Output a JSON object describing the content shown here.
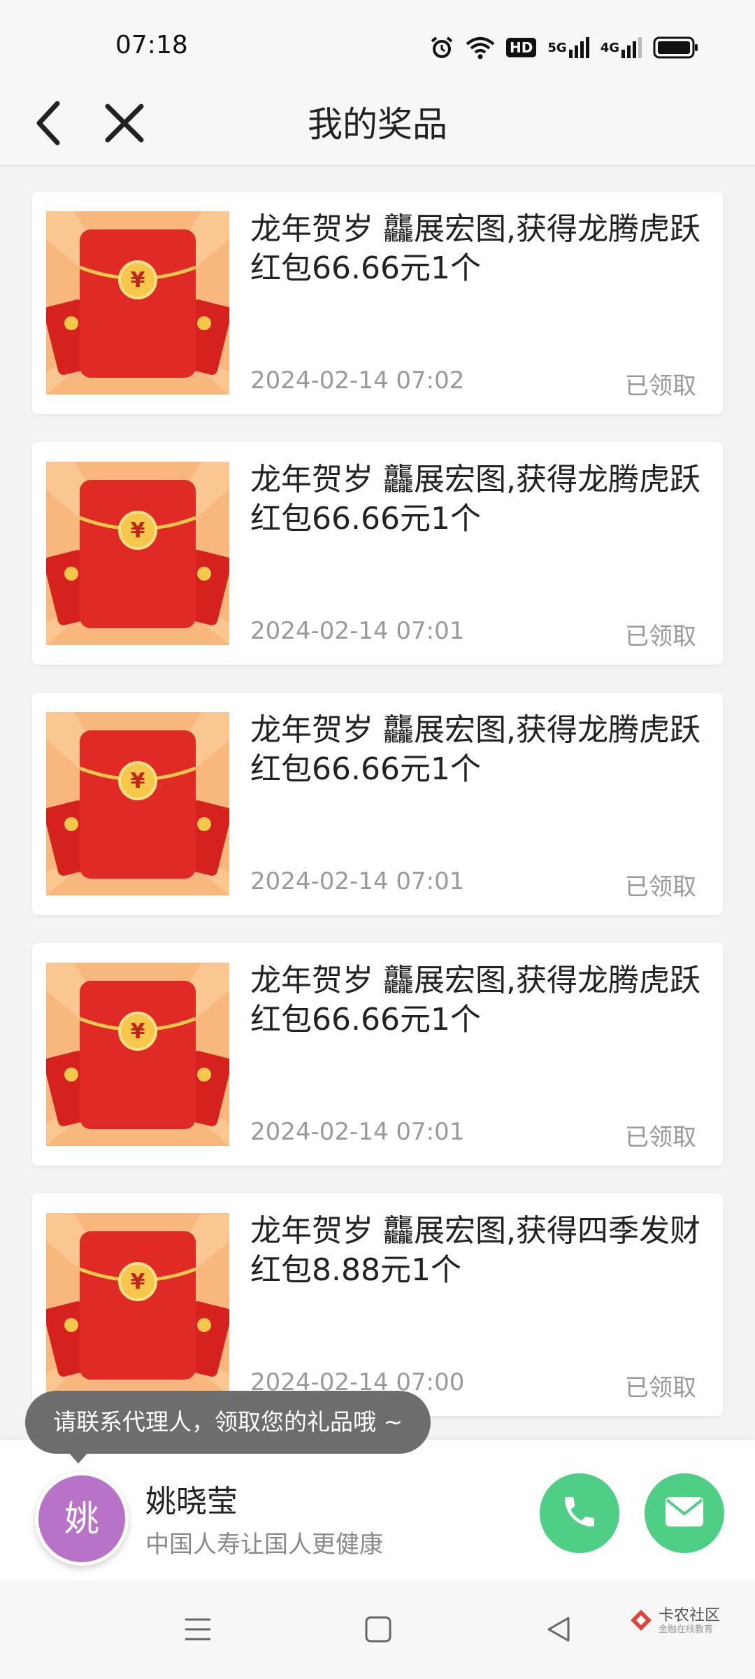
{
  "status_bar": {
    "time": "07:18",
    "icons": [
      "alarm-icon",
      "wifi-icon",
      "hd-icon",
      "signal-5g-icon",
      "signal-4g-icon",
      "battery-icon"
    ],
    "hd_label": "HD",
    "net1_label": "5G",
    "net2_label": "4G"
  },
  "header": {
    "title": "我的奖品",
    "back_icon": "chevron-left-icon",
    "close_icon": "close-icon"
  },
  "prizes": [
    {
      "title": "龙年贺岁 龘展宏图,获得龙腾虎跃红包66.66元1个",
      "time": "2024-02-14 07:02",
      "status": "已领取"
    },
    {
      "title": "龙年贺岁 龘展宏图,获得龙腾虎跃红包66.66元1个",
      "time": "2024-02-14 07:01",
      "status": "已领取"
    },
    {
      "title": "龙年贺岁 龘展宏图,获得龙腾虎跃红包66.66元1个",
      "time": "2024-02-14 07:01",
      "status": "已领取"
    },
    {
      "title": "龙年贺岁 龘展宏图,获得龙腾虎跃红包66.66元1个",
      "time": "2024-02-14 07:01",
      "status": "已领取"
    },
    {
      "title": "龙年贺岁 龘展宏图,获得四季发财红包8.88元1个",
      "time": "2024-02-14 07:00",
      "status": "已领取"
    }
  ],
  "thumbnail": {
    "coin_symbol": "¥",
    "icon": "red-envelope-icon"
  },
  "tooltip": {
    "text": "请联系代理人，领取您的礼品哦 ~"
  },
  "agent": {
    "avatar_text": "姚",
    "name": "姚晓莹",
    "slogan": "中国人寿让国人更健康"
  },
  "watermark": {
    "line1": "卡农社区",
    "line2": "金融在线教育"
  },
  "colors": {
    "accent_green": "#4fcf86",
    "avatar_purple": "#b873c8",
    "envelope_red": "#e02a26",
    "status_gray": "#9a9a9a"
  }
}
